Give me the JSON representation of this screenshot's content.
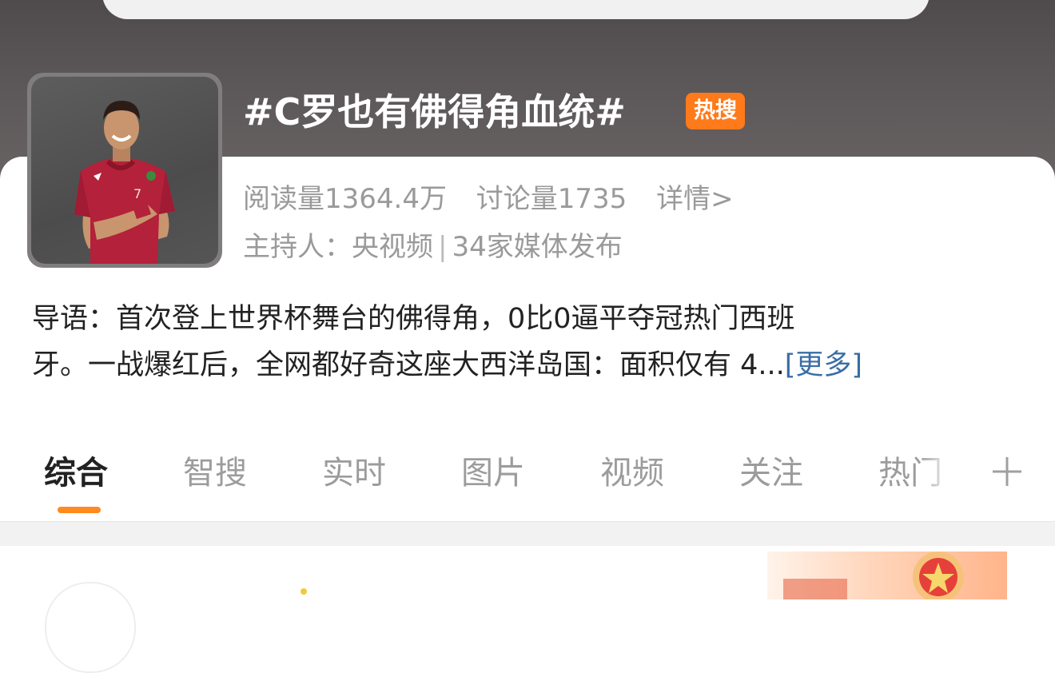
{
  "topic": {
    "title": "#C罗也有佛得角血统#",
    "badge": "热搜"
  },
  "stats": {
    "reads": "阅读量1364.4万",
    "discussions": "讨论量1735",
    "details_link": "详情>"
  },
  "host": {
    "label": "主持人：央视频",
    "separator": "|",
    "media": "34家媒体发布"
  },
  "intro": {
    "line1": "导语：首次登上世界杯舞台的佛得角，0比0逼平夺冠热门西班",
    "line2": "牙。一战爆红后，全网都好奇这座大西洋岛国：面积仅有 4...",
    "more_link": "[更多]"
  },
  "tabs": [
    {
      "label": "综合",
      "active": true
    },
    {
      "label": "智搜",
      "active": false
    },
    {
      "label": "实时",
      "active": false
    },
    {
      "label": "图片",
      "active": false
    },
    {
      "label": "视频",
      "active": false
    },
    {
      "label": "关注",
      "active": false
    },
    {
      "label": "热门",
      "active": false
    }
  ],
  "icons": {
    "add_tab": "plus-icon"
  },
  "colors": {
    "hot_badge": "#ff7a1a",
    "tab_indicator": "#ff8a1f",
    "more_link": "#3a6ea5",
    "header_bg": "#5a5556"
  }
}
